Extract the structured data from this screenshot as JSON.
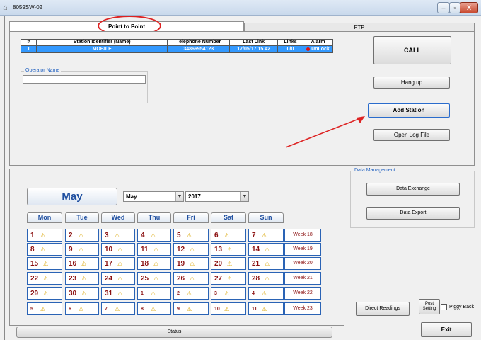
{
  "window": {
    "title": "8059SW-02",
    "close_glyph": "X"
  },
  "tabs": [
    {
      "label": "Point to Point"
    },
    {
      "label": "FTP"
    }
  ],
  "stations": {
    "headers": [
      "#",
      "Station Identifier (Name)",
      "Telephone Number",
      "Last Link",
      "Links",
      "Alarm"
    ],
    "rows": [
      {
        "num": "1",
        "name": "MOBILE",
        "phone": "34866954123",
        "last_link": "17/05/17 15.42",
        "links": "0/0",
        "alarm": "UnLock"
      }
    ]
  },
  "operator": {
    "legend": "Operator Name",
    "value": ""
  },
  "buttons": {
    "call": "CALL",
    "hangup": "Hang up",
    "add_station": "Add Station",
    "open_log": "Open Log File",
    "data_exchange": "Data Exchange",
    "data_export": "Data Export",
    "direct_readings": "Direct Readings",
    "post_setting_line1": "Post",
    "post_setting_line2": "Setting",
    "exit": "Exit"
  },
  "data_management": {
    "legend": "Data Management"
  },
  "piggy_back": {
    "label": "Piggy Back",
    "checked": false
  },
  "calendar": {
    "month_title": "May",
    "month_select": "May",
    "year_select": "2017",
    "days": [
      "Mon",
      "Tue",
      "Wed",
      "Thu",
      "Fri",
      "Sat",
      "Sun"
    ],
    "weeks": [
      {
        "label": "Week 18",
        "dates": [
          "1",
          "2",
          "3",
          "4",
          "5",
          "6",
          "7"
        ]
      },
      {
        "label": "Week 19",
        "dates": [
          "8",
          "9",
          "10",
          "11",
          "12",
          "13",
          "14"
        ]
      },
      {
        "label": "Week 20",
        "dates": [
          "15",
          "16",
          "17",
          "18",
          "19",
          "20",
          "21"
        ]
      },
      {
        "label": "Week 21",
        "dates": [
          "22",
          "23",
          "24",
          "25",
          "26",
          "27",
          "28"
        ]
      },
      {
        "label": "Week 22",
        "dates": [
          "29",
          "30",
          "31",
          "1",
          "2",
          "3",
          "4"
        ]
      },
      {
        "label": "Week 23",
        "dates": [
          "5",
          "6",
          "7",
          "8",
          "9",
          "10",
          "11"
        ]
      }
    ],
    "warning_glyph": "⚠"
  },
  "status": {
    "label": "Status"
  },
  "colors": {
    "accent": "#3399ff",
    "date_text": "#8b1010",
    "annotation": "#dd2222"
  }
}
